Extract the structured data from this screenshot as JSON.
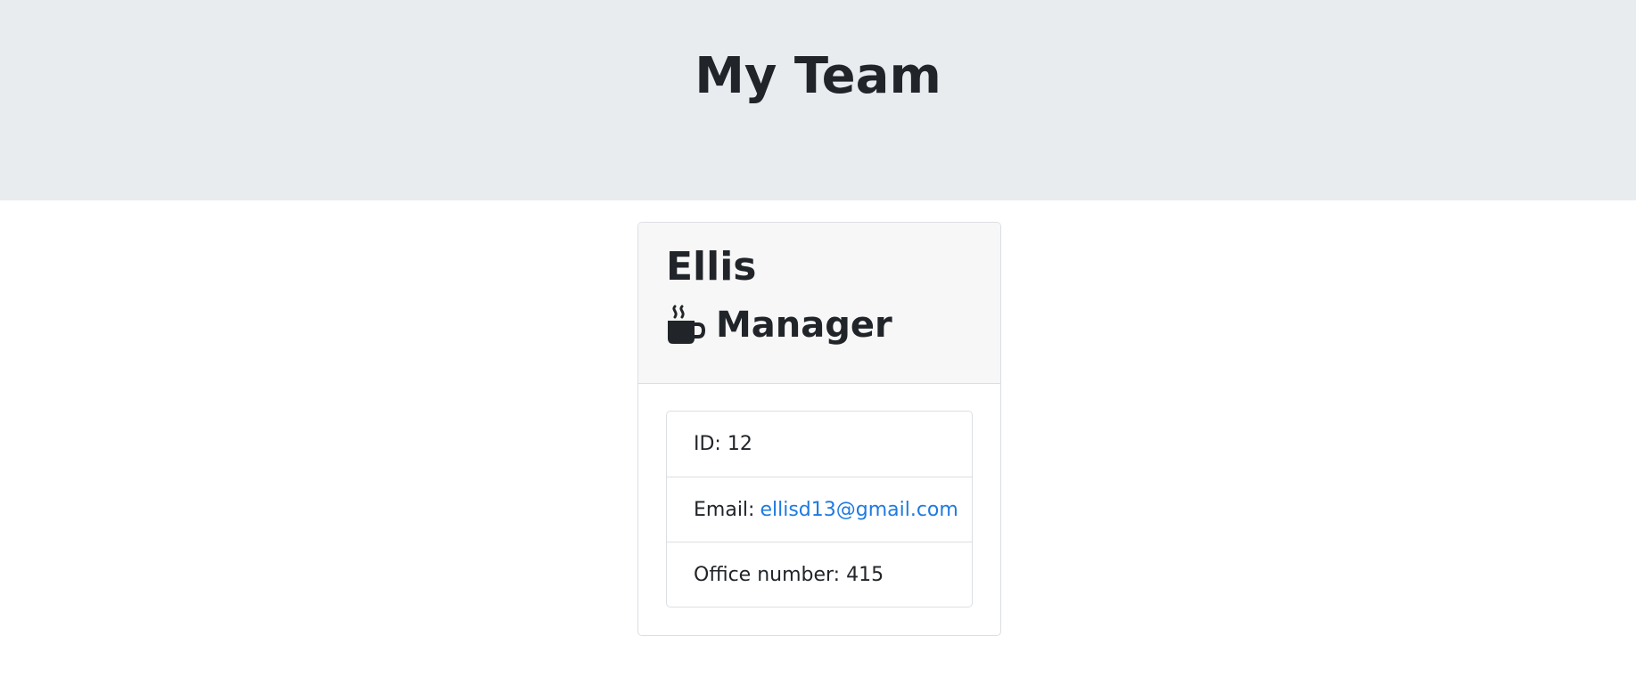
{
  "header": {
    "title": "My Team"
  },
  "card": {
    "name": "Ellis",
    "role": "Manager",
    "role_icon": "coffee-mug-icon",
    "details": {
      "id_label": "ID:",
      "id_value": "12",
      "email_label": "Email:",
      "email_value": "ellisd13@gmail.com",
      "office_label": "Office number:",
      "office_value": "415"
    }
  },
  "colors": {
    "header_bg": "#e9ecef",
    "card_header_bg": "#f7f7f7",
    "link": "#1f7ae0",
    "text": "#212529"
  }
}
